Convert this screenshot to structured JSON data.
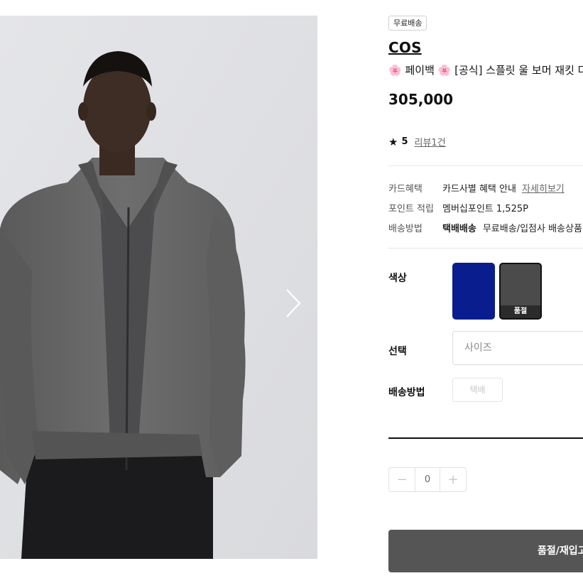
{
  "product": {
    "badge": "무료배송",
    "brand": "COS",
    "title_flower": "🌸",
    "title_part1": "페이백",
    "title_part2": "[공식] 스플릿 울 보머 재킷 다",
    "price": "305,000",
    "rating_score": "5",
    "reviews_link": "리뷰1건"
  },
  "info": {
    "card_label": "카드혜택",
    "card_value": "카드사별 혜택 안내",
    "card_link": "자세히보기",
    "point_label": "포인트 적립",
    "point_value": "멤버십포인트 1,525P",
    "ship_label": "배송방법",
    "ship_bold": "택배배송",
    "ship_value": "무료배송/입점사 배송상품"
  },
  "options": {
    "color_label": "색상",
    "colors": [
      {
        "name": "navy",
        "hex": "#0a1d8f",
        "soldout": ""
      },
      {
        "name": "dark-gray",
        "hex": "#4b4b4b",
        "soldout": "품절"
      }
    ],
    "select_label": "선택",
    "size_placeholder": "사이즈",
    "delivery_label": "배송방법",
    "delivery_option": "택배"
  },
  "quantity": {
    "minus": "−",
    "value": "0",
    "plus": "+"
  },
  "cta": {
    "label": "품절/재입고"
  },
  "icons": {
    "next": "chevron-right-icon",
    "star": "star-icon"
  }
}
